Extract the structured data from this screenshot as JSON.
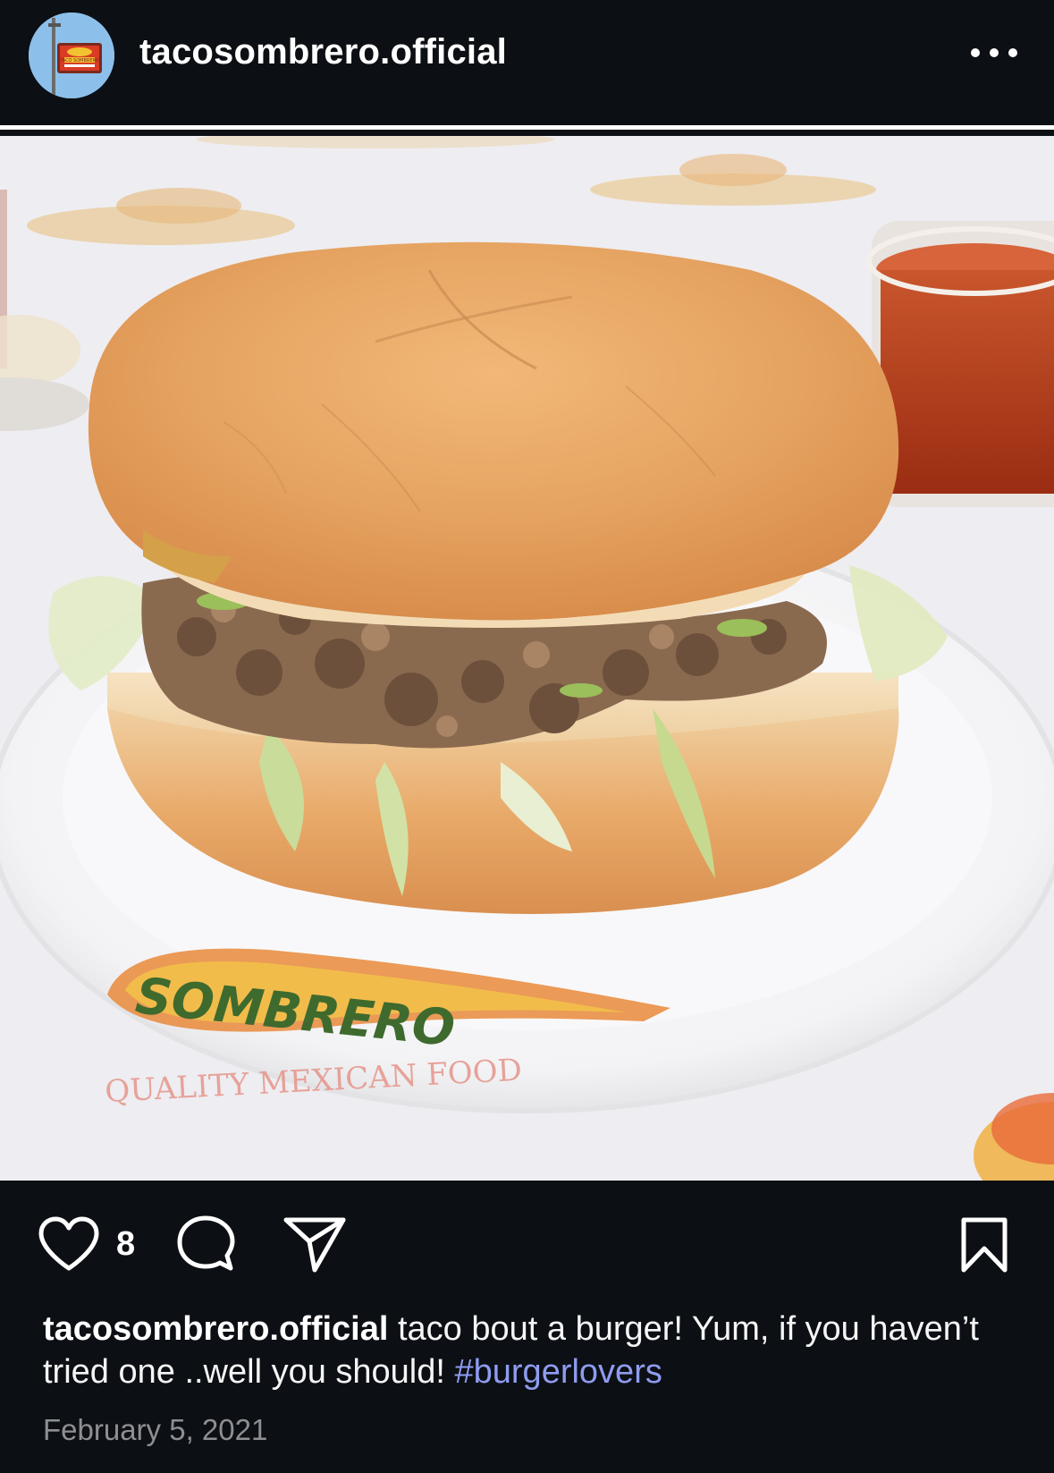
{
  "header": {
    "username": "tacosombrero.official",
    "avatar_sign_text": "TACO SOMBRERO"
  },
  "photo": {
    "wrapper_brand": "SOMBRERO",
    "wrapper_tagline": "QUALITY MEXICAN FOOD"
  },
  "actions": {
    "like_count": "8",
    "icons": [
      "heart-icon",
      "comment-icon",
      "share-icon",
      "bookmark-icon"
    ]
  },
  "caption": {
    "username": "tacosombrero.official",
    "text": " taco bout a burger! Yum, if you haven’t tried one ..well you should! ",
    "hashtag": "#burgerlovers"
  },
  "date": "February 5, 2021",
  "colors": {
    "background": "#0c0f14",
    "hashtag": "#8e9cf0",
    "date": "#8e8f93"
  }
}
